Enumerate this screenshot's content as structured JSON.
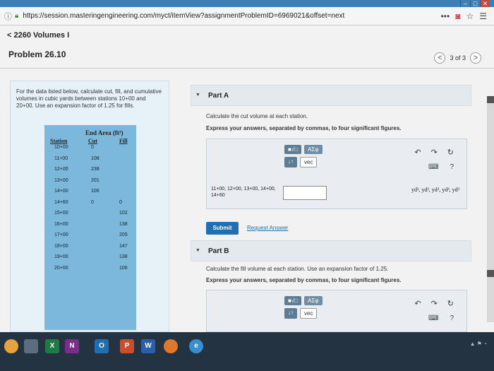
{
  "browser": {
    "url": "https://session.masteringengineering.com/myct/itemView?assignmentProblemID=6969021&offset=next",
    "tools": [
      "more-icon",
      "pocket-icon",
      "star-icon",
      "menu-icon"
    ]
  },
  "page": {
    "breadcrumb": "< 2260 Volumes I",
    "problem_title": "Problem 26.10",
    "pager": "3 of 3",
    "pager_prev": "<",
    "pager_next": ">"
  },
  "problem": {
    "text": "For the data listed below, calculate cut, fill, and cumulative volumes in cubic yards between stations 10+00 and 20+00. Use an expansion factor of 1.25 for fills.",
    "table": {
      "header_end_area": "End Area (ft²)",
      "header_station": "Station",
      "header_cut": "Cut",
      "header_fill": "Fill",
      "rows": [
        {
          "station": "10+00",
          "cut": "0",
          "fill": ""
        },
        {
          "station": "11+00",
          "cut": "108",
          "fill": ""
        },
        {
          "station": "12+00",
          "cut": "238",
          "fill": ""
        },
        {
          "station": "13+00",
          "cut": "201",
          "fill": ""
        },
        {
          "station": "14+00",
          "cut": "106",
          "fill": ""
        },
        {
          "station": "14+60",
          "cut": "0",
          "fill": "0"
        },
        {
          "station": "15+00",
          "cut": "",
          "fill": "102"
        },
        {
          "station": "16+00",
          "cut": "",
          "fill": "138"
        },
        {
          "station": "17+00",
          "cut": "",
          "fill": "205"
        },
        {
          "station": "18+00",
          "cut": "",
          "fill": "147"
        },
        {
          "station": "19+00",
          "cut": "",
          "fill": "138"
        },
        {
          "station": "20+00",
          "cut": "",
          "fill": "106"
        }
      ]
    }
  },
  "part_a": {
    "label": "Part A",
    "instruction": "Calculate the cut volume at each station.",
    "format_instruction": "Express your answers, separated by commas, to four significant figures.",
    "toolbar": {
      "templates": "■√□",
      "symbols": "ΑΣφ",
      "arrows": "↓↑",
      "vec": "vec",
      "help": "?"
    },
    "prompt": "11+00, 12+00, 13+00, 14+00, 14+60",
    "answer_value": "",
    "units": "yd³, yd³, yd³, yd³, yd³",
    "submit": "Submit",
    "request": "Request Answer"
  },
  "part_b": {
    "label": "Part B",
    "instruction": "Calculate the fill volume at each station. Use an expansion factor of 1.25.",
    "format_instruction": "Express your answers, separated by commas, to four significant figures.",
    "toolbar": {
      "templates": "■√□",
      "symbols": "ΑΣφ",
      "arrows": "↓↑",
      "vec": "vec",
      "help": "?"
    }
  }
}
